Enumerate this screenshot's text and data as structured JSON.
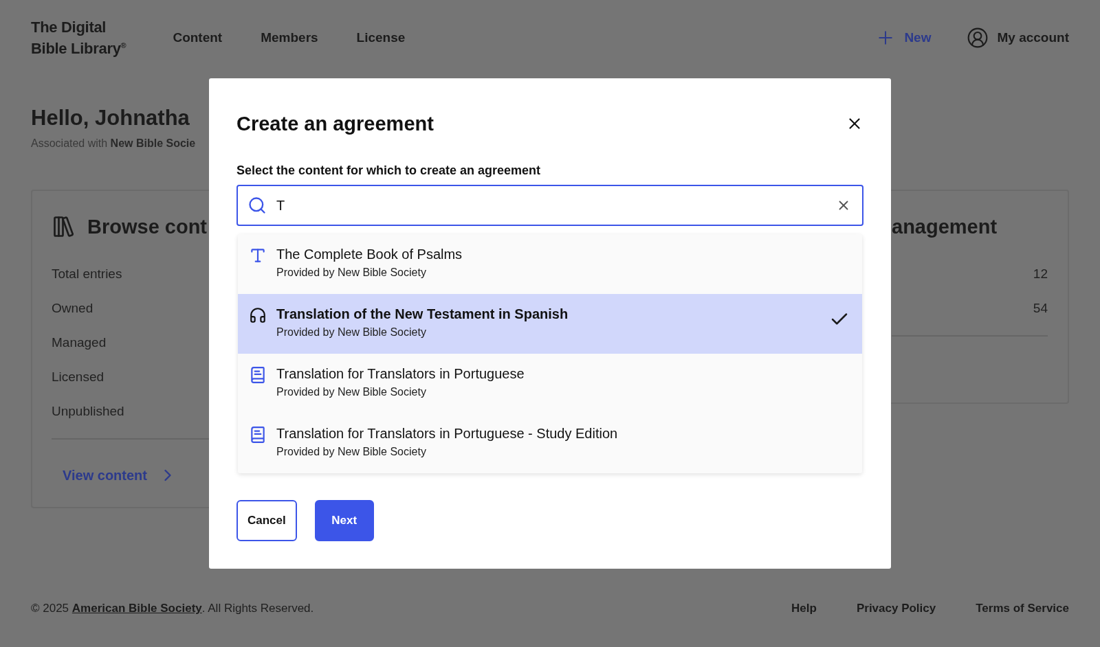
{
  "header": {
    "logo": [
      "The Digital",
      "Bible Library$^{®}$"
    ],
    "nav": [
      "Content",
      "Members",
      "License"
    ],
    "new_button": "New",
    "account_button": "My account"
  },
  "greeting": {
    "title": "Hello, Johnatha",
    "association": "Associated with **New Bible Socie**"
  },
  "browse_card": {
    "title": "Browse cont",
    "rows": [
      "Total entries",
      "Owned",
      "Managed",
      "Licensed",
      "Unpublished"
    ],
    "link": "View content"
  },
  "management_card": {
    "title": "anagement",
    "values": [
      "12",
      "54"
    ]
  },
  "modal": {
    "title": "Create an agreement",
    "label": "Select the content for which to create an agreement",
    "search": {
      "value": "T"
    },
    "options": [
      {
        "kind": "text",
        "title": "The Complete Book of Psalms",
        "provider": "Provided by New Bible Society",
        "selected": false
      },
      {
        "kind": "audio",
        "title": "Translation of the New Testament in Spanish",
        "provider": "Provided by New Bible Society",
        "selected": true
      },
      {
        "kind": "book",
        "title": "Translation for Translators in Portuguese",
        "provider": "Provided by New Bible Society",
        "selected": false
      },
      {
        "kind": "book",
        "title": "Translation for Translators in Portuguese - Study Edition",
        "provider": "Provided by New Bible Society",
        "selected": false
      }
    ],
    "cancel_button": "Cancel",
    "next_button": "Next"
  },
  "footer": {
    "copyright_before": "© 2025 ",
    "copyright_link": "American Bible Society",
    "copyright_after": ". All Rights Reserved.",
    "links": [
      "Help",
      "Privacy Policy",
      "Terms of Service"
    ]
  }
}
